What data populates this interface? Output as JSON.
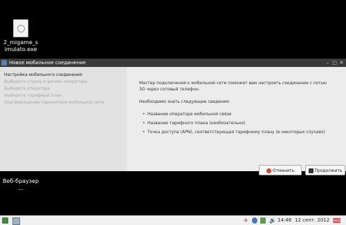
{
  "desktop": {
    "icons": [
      {
        "label": "2_migame_s imulato.exe"
      },
      {
        "label": "Веб-браузер ..."
      }
    ]
  },
  "dialog": {
    "title": "Новое мобильное соединение",
    "steps": [
      {
        "label": "Настройка мобильного соединения",
        "active": true
      },
      {
        "label": "Выберите страну и регион оператора",
        "active": false
      },
      {
        "label": "Выберите оператора",
        "active": false
      },
      {
        "label": "Выберите тарифный план",
        "active": false
      },
      {
        "label": "Подтверждение параметров мобильной сети",
        "active": false
      }
    ],
    "intro_line1": "Мастер подключения к мобильной сети поможет вам настроить соединение с сетью",
    "intro_line2": "3G через сотовый телефон.",
    "need_to_know": "Необходимо знать следующие сведения:",
    "bullets": [
      "Название оператора мобильной связи",
      "Название тарифного плана (необязательно)",
      "Точка доступа (APN), соответствующая тарифному плану (в некоторых случаях)"
    ],
    "cancel_label": "Отменить",
    "continue_label": "Продолжить"
  },
  "taskbar": {
    "time": "14:48",
    "date": "12 сент. 2012"
  },
  "colors": {
    "titlebar": "#3a3a3a",
    "dialog_bg": "#e2e2e2",
    "panel_bg": "#ececec",
    "cancel_icon": "#d9412b",
    "continue_icon": "#333333",
    "taskbar": "#f0f0f0"
  }
}
